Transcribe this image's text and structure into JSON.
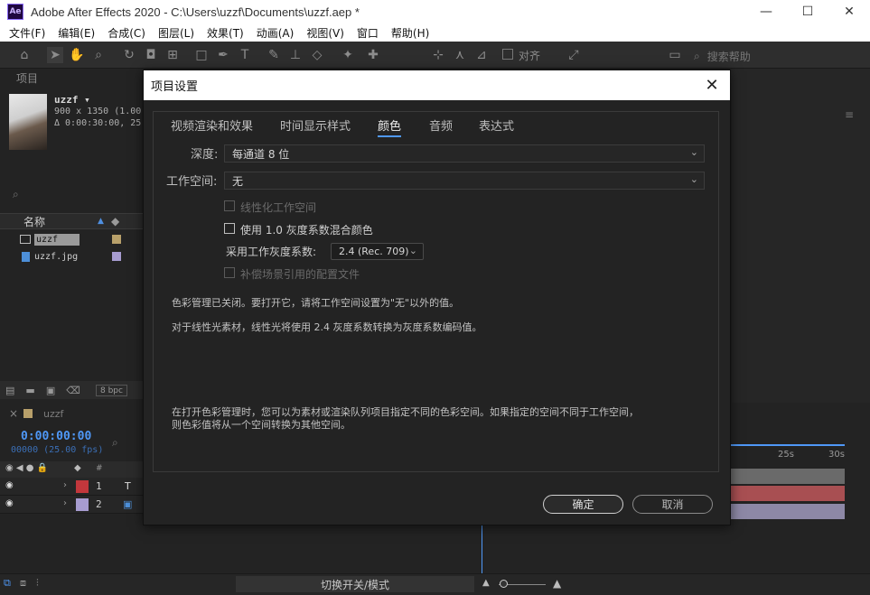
{
  "window": {
    "logo": "Ae",
    "title": "Adobe After Effects 2020 - C:\\Users\\uzzf\\Documents\\uzzf.aep *",
    "minimize": "—",
    "maximize": "☐",
    "close": "✕"
  },
  "menu": [
    "文件(F)",
    "编辑(E)",
    "合成(C)",
    "图层(L)",
    "效果(T)",
    "动画(A)",
    "视图(V)",
    "窗口",
    "帮助(H)"
  ],
  "toolbar": {
    "align_label": "对齐",
    "search_placeholder": "搜索帮助"
  },
  "project": {
    "tab_label": "项目",
    "comp_name": "uzzf ▾",
    "comp_dims": "900 x 1350 (1.00)",
    "comp_duration": "Δ 0:00:30:00, 25.00 fps",
    "search_icon": "⌕",
    "col_name": "名称",
    "items": [
      {
        "name": "uzzf",
        "color": "#b8a06a"
      },
      {
        "name": "uzzf.jpg",
        "color": "#a79cd0"
      }
    ],
    "bpc_label": "8 bpc"
  },
  "timeline": {
    "comp_tab": "uzzf",
    "timecode": "0:00:00:00",
    "fps": "00000 (25.00 fps)",
    "layers": [
      {
        "num": "1",
        "type": "T",
        "color": "#c2373c"
      },
      {
        "num": "2",
        "type": "▣",
        "color": "#a79cd0"
      }
    ],
    "ruler_labels": [
      "25s",
      "30s"
    ],
    "toggle_label": "切换开关/模式"
  },
  "dialog": {
    "title": "项目设置",
    "tabs": [
      "视频渲染和效果",
      "时间显示样式",
      "颜色",
      "音频",
      "表达式"
    ],
    "active_tab": "颜色",
    "depth_label": "深度:",
    "depth_value": "每通道 8 位",
    "workspace_label": "工作空间:",
    "workspace_value": "无",
    "linearize_label": "线性化工作空间",
    "blend_label": "使用 1.0 灰度系数混合颜色",
    "gamma_label": "采用工作灰度系数:",
    "gamma_value": "2.4 (Rec. 709)",
    "compensate_label": "补偿场景引用的配置文件",
    "note1": "色彩管理已关闭。要打开它，请将工作空间设置为\"无\"以外的值。",
    "note2": "对于线性光素材，线性光将使用 2.4 灰度系数转换为灰度系数编码值。",
    "note3_line1": "在打开色彩管理时，您可以为素材或渲染队列项目指定不同的色彩空间。如果指定的空间不同于工作空间，",
    "note3_line2": "则色彩值将从一个空间转换为其他空间。",
    "ok_label": "确定",
    "cancel_label": "取消"
  }
}
